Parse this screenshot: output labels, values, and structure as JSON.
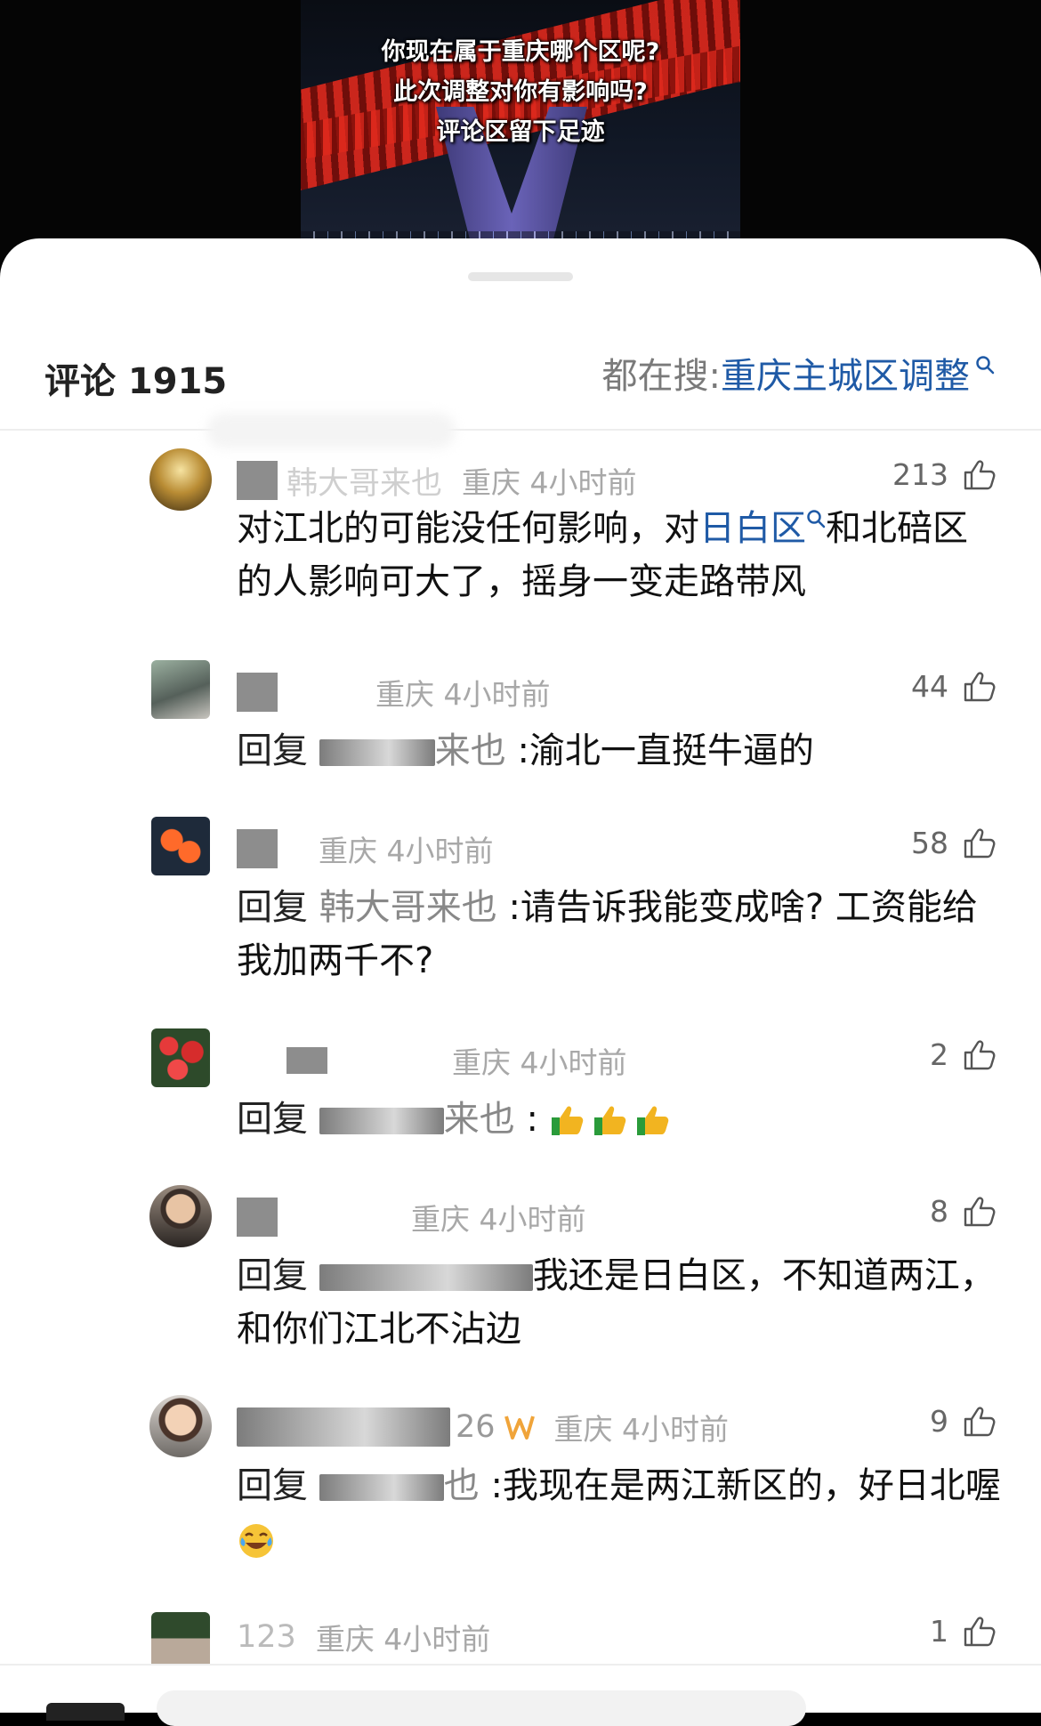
{
  "video": {
    "caption_lines": [
      "你现在属于重庆哪个区呢?",
      "此次调整对你有影响吗?",
      "评论区留下足迹"
    ]
  },
  "comments_panel": {
    "title": "评论 1915",
    "trending_label": "都在搜:",
    "trending_term": "重庆主城区调整"
  },
  "comments": [
    {
      "user": "韩大哥来也",
      "location_time": "重庆 4小时前",
      "likes": "213",
      "text_before": "对江北的可能没任何影响，对",
      "link": "日白区",
      "text_after": "和北碚区的人影响可大了，摇身一变走路带风"
    },
    {
      "user": "",
      "location_time": "重庆 4小时前",
      "likes": "44",
      "reply_prefix": "回复",
      "target_suffix": "来也",
      "text": ":渝北一直挺牛逼的"
    },
    {
      "user": "",
      "location_time": "重庆 4小时前",
      "likes": "58",
      "reply_prefix": "回复",
      "target": "韩大哥来也",
      "text": ":请告诉我能变成啥? 工资能给我加两千不?"
    },
    {
      "user": "",
      "location_time": "重庆 4小时前",
      "likes": "2",
      "reply_prefix": "回复",
      "target_suffix": "来也",
      "text": ":",
      "emoji": [
        "thumbs-up",
        "thumbs-up",
        "thumbs-up"
      ]
    },
    {
      "user": "",
      "location_time": "重庆 4小时前",
      "likes": "8",
      "reply_prefix": "回复",
      "text": "我还是日白区，不知道两江，和你们江北不沾边"
    },
    {
      "user": "26",
      "location_time": "重庆 4小时前",
      "likes": "9",
      "reply_prefix": "回复",
      "target_suffix": "也",
      "text": ":我现在是两江新区的，好日北喔",
      "emoji": [
        "laughing-crying"
      ]
    },
    {
      "user": "123",
      "location_time": "重庆 4小时前",
      "likes": "1"
    }
  ],
  "colors": {
    "link_blue": "#1f5aa6",
    "meta_gray": "#a8a8a8"
  }
}
